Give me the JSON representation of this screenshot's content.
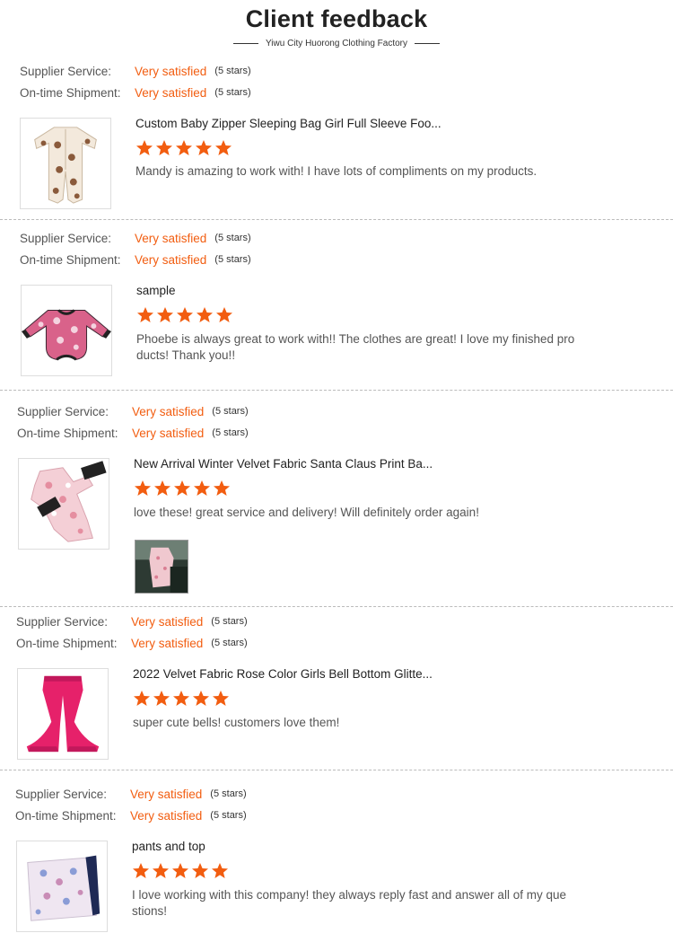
{
  "page": {
    "title": "Client feedback",
    "subtitle": "Yiwu City Huorong Clothing Factory"
  },
  "colors": {
    "accent": "#f25d10",
    "divider": "#bbbbbb"
  },
  "labels": {
    "supplier_service": "Supplier Service:",
    "ontime_shipment": "On-time Shipment:"
  },
  "reviews": [
    {
      "supplier_value": "Very satisfied",
      "supplier_stars": "(5 stars)",
      "shipment_value": "Very satisfied",
      "shipment_stars": "(5 stars)",
      "product_title": "Custom Baby Zipper Sleeping Bag Girl Full Sleeve Foo...",
      "rating": 5,
      "comment": "Mandy is amazing to work with! I have lots of compliments on my products."
    },
    {
      "supplier_value": "Very satisfied",
      "supplier_stars": "(5 stars)",
      "shipment_value": "Very satisfied",
      "shipment_stars": "(5 stars)",
      "product_title": "sample",
      "rating": 5,
      "comment": "Phoebe is always great to work with!! The clothes are great! I love my finished pro ducts! Thank you!!"
    },
    {
      "supplier_value": "Very satisfied",
      "supplier_stars": "(5 stars)",
      "shipment_value": "Very satisfied",
      "shipment_stars": "(5 stars)",
      "product_title": "New Arrival Winter Velvet Fabric Santa Claus Print Ba...",
      "rating": 5,
      "comment": "love these! great service and delivery! Will definitely order again!"
    },
    {
      "supplier_value": "Very satisfied",
      "supplier_stars": "(5 stars)",
      "shipment_value": "Very satisfied",
      "shipment_stars": "(5 stars)",
      "product_title": "2022 Velvet Fabric Rose Color Girls Bell Bottom Glitte...",
      "rating": 5,
      "comment": "super cute bells! customers love them!"
    },
    {
      "supplier_value": "Very satisfied",
      "supplier_stars": "(5 stars)",
      "shipment_value": "Very satisfied",
      "shipment_stars": "(5 stars)",
      "product_title": "pants and top",
      "rating": 5,
      "comment": "I love working with this company! they always reply fast and answer all of my que stions!"
    }
  ]
}
